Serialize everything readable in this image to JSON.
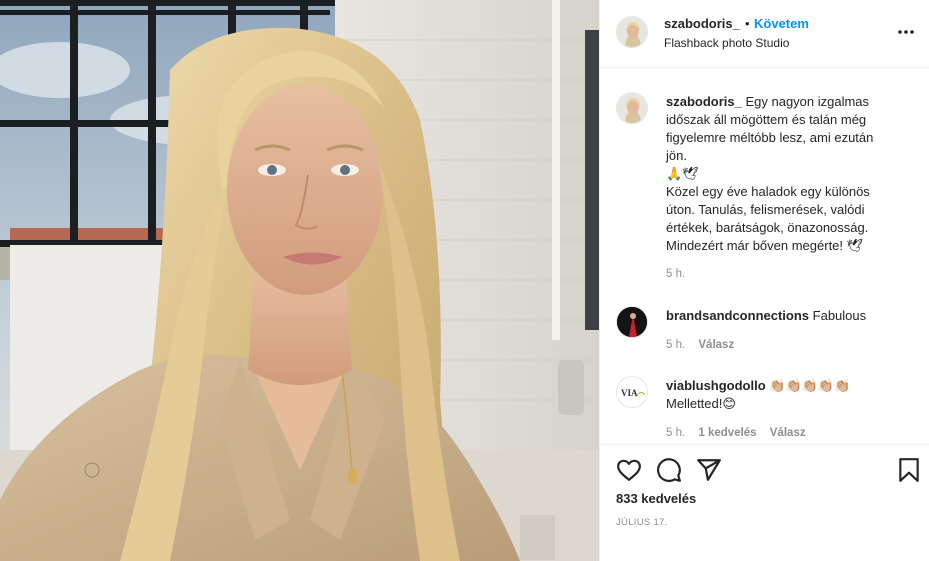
{
  "post": {
    "author": "szabodoris_",
    "separator": "•",
    "follow_label": "Követem",
    "location": "Flashback photo Studio",
    "more_icon": "more-horizontal-icon"
  },
  "caption": {
    "username": "szabodoris_",
    "text_line1": " Egy nagyon izgalmas",
    "text_line2": "időszak áll mögöttem és talán még",
    "text_line3": "figyelemre méltóbb lesz, ami ezután",
    "text_line4": "jön.",
    "emoji_line": "🙏🕊",
    "text_line5": "Közel egy éve haladok egy különös",
    "text_line6": "úton. Tanulás, felismerések, valódi",
    "text_line7": "értékek, barátságok, önazonosság.",
    "text_line8": "Mindezért már bőven megérte! 🕊",
    "time": "5 h."
  },
  "comments": [
    {
      "username": "brandsandconnections",
      "text": " Fabulous",
      "time": "5 h.",
      "reply_label": "Válasz"
    },
    {
      "username": "viablushgodollo",
      "text": " 👏🏼👏🏼👏🏼👏🏼👏🏼",
      "text_line2": "Melletted!😊",
      "time": "5 h.",
      "likes": "1 kedvelés",
      "reply_label": "Válasz",
      "avatar_text": "VIA"
    }
  ],
  "actions": {
    "icons": [
      "heart-icon",
      "comment-icon",
      "share-icon",
      "bookmark-icon"
    ],
    "like_count": "833 kedvelés",
    "date": "július 17."
  },
  "colors": {
    "accent": "#0095f6",
    "text": "#262626",
    "muted": "#8e8e8e",
    "border": "#efefef"
  }
}
